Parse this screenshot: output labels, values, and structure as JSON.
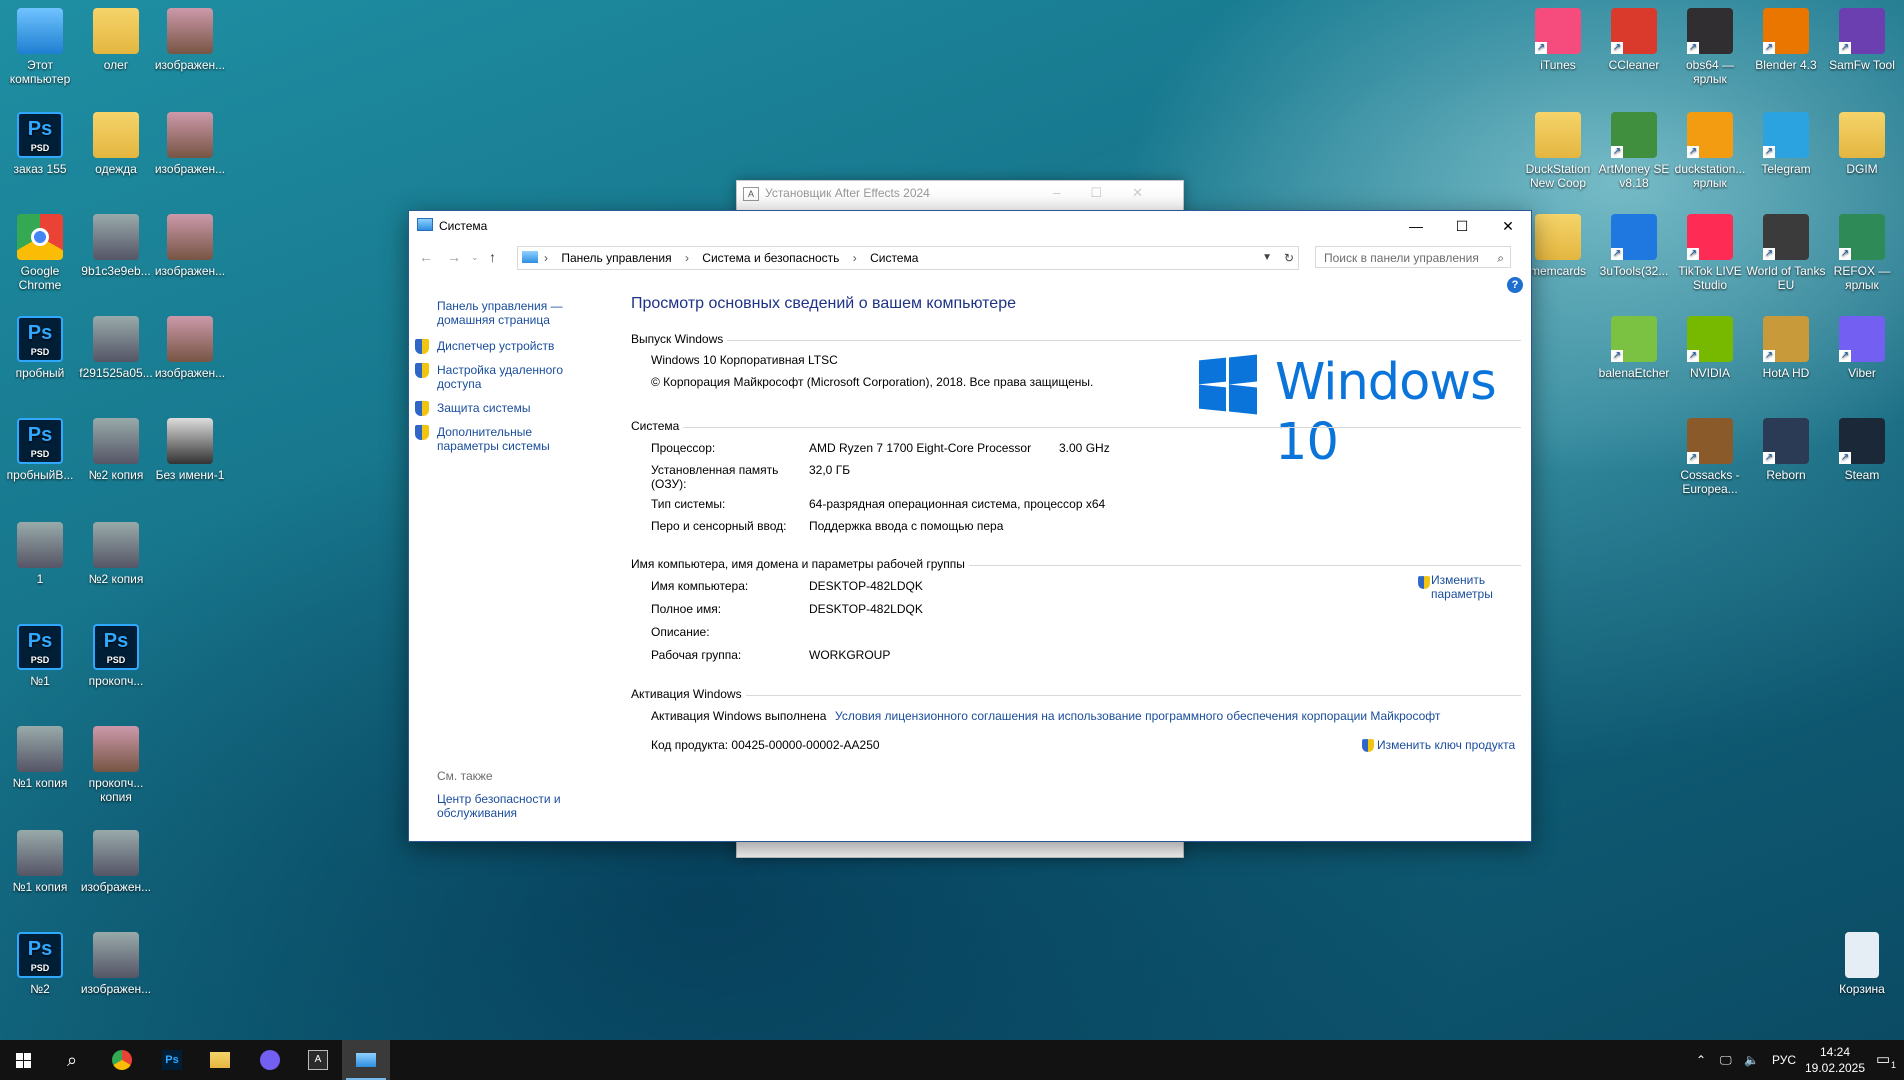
{
  "desktop": {
    "left_icons": [
      {
        "label": "Этот компьютер",
        "icon": "computer-icon"
      },
      {
        "label": "олег",
        "icon": "folder-icon"
      },
      {
        "label": "изображен...",
        "icon": "photo-icon"
      },
      {
        "label": "заказ 155",
        "icon": "psd-icon"
      },
      {
        "label": "одежда",
        "icon": "folder-icon"
      },
      {
        "label": "изображен...",
        "icon": "photo-icon"
      },
      {
        "label": "Google Chrome",
        "icon": "chrome-icon"
      },
      {
        "label": "9b1c3e9eb...",
        "icon": "photo-icon"
      },
      {
        "label": "изображен...",
        "icon": "photo-icon"
      },
      {
        "label": "пробный",
        "icon": "psd-icon"
      },
      {
        "label": "f291525a05...",
        "icon": "photo-icon"
      },
      {
        "label": "изображен...",
        "icon": "photo-icon"
      },
      {
        "label": "пробныйВ...",
        "icon": "psd-icon"
      },
      {
        "label": "№2 копия",
        "icon": "photo-icon"
      },
      {
        "label": "Без имени-1",
        "icon": "image-icon"
      },
      {
        "label": "1",
        "icon": "photo-icon"
      },
      {
        "label": "№2 копия",
        "icon": "photo-icon"
      },
      {
        "label": "№1",
        "icon": "psd-icon"
      },
      {
        "label": "прокопч...",
        "icon": "psd-icon"
      },
      {
        "label": "№1 копия",
        "icon": "photo-icon"
      },
      {
        "label": "прокопч... копия",
        "icon": "photo-icon"
      },
      {
        "label": "№1 копия",
        "icon": "photo-icon"
      },
      {
        "label": "изображен...",
        "icon": "photo-icon"
      },
      {
        "label": "№2",
        "icon": "psd-icon"
      },
      {
        "label": "изображен...",
        "icon": "photo-icon"
      }
    ],
    "right_icons": [
      {
        "label": "iTunes",
        "icon": "itunes-icon",
        "color": "#f54b7d"
      },
      {
        "label": "CCleaner",
        "icon": "ccleaner-icon",
        "color": "#d93a2b"
      },
      {
        "label": "obs64 — ярлык",
        "icon": "obs-icon",
        "color": "#302e31"
      },
      {
        "label": "Blender 4.3",
        "icon": "blender-icon",
        "color": "#ea7600"
      },
      {
        "label": "SamFw Tool",
        "icon": "samfw-icon",
        "color": "#6b3fb0"
      },
      {
        "label": "DuckStation New Coop",
        "icon": "folder-icon",
        "color": "#e8c04f"
      },
      {
        "label": "ArtMoney SE v8.18",
        "icon": "artmoney-icon",
        "color": "#3f8f3f"
      },
      {
        "label": "duckstation... ярлык",
        "icon": "duckstation-icon",
        "color": "#f39c12"
      },
      {
        "label": "Telegram",
        "icon": "telegram-icon",
        "color": "#2aa3e0"
      },
      {
        "label": "DGIM",
        "icon": "folder-icon",
        "color": "#e8c04f"
      },
      {
        "label": "memcards",
        "icon": "folder-icon",
        "color": "#e8c04f"
      },
      {
        "label": "3uTools(32...",
        "icon": "3utools-icon",
        "color": "#1f78e0"
      },
      {
        "label": "TikTok LIVE Studio",
        "icon": "tiktok-icon",
        "color": "#fe2c55"
      },
      {
        "label": "World of Tanks EU",
        "icon": "wot-icon",
        "color": "#3b3b3b"
      },
      {
        "label": "REFOX — ярлык",
        "icon": "refox-icon",
        "color": "#2e8b57"
      },
      {
        "label": "balenaEtcher",
        "icon": "etcher-icon",
        "color": "#7cc242"
      },
      {
        "label": "NVIDIA",
        "icon": "nvidia-icon",
        "color": "#76b900"
      },
      {
        "label": "HotA HD",
        "icon": "hota-icon",
        "color": "#c99a3a"
      },
      {
        "label": "Viber",
        "icon": "viber-icon",
        "color": "#7360f2"
      },
      {
        "label": "Cossacks - Europea...",
        "icon": "cossacks-icon",
        "color": "#8b5a2b"
      },
      {
        "label": "Reborn",
        "icon": "reborn-icon",
        "color": "#2b3a55"
      },
      {
        "label": "Steam",
        "icon": "steam-icon",
        "color": "#1b2838"
      },
      {
        "label": "Корзина",
        "icon": "recycle-bin-icon",
        "color": "#e6eef5"
      }
    ]
  },
  "background_window": {
    "title": "Установщик After Effects 2024"
  },
  "window": {
    "title": "Система",
    "minimize": "—",
    "maximize": "☐",
    "close": "✕",
    "address": {
      "parts": [
        "Панель управления",
        "Система и безопасность",
        "Система"
      ],
      "search_placeholder": "Поиск в панели управления"
    },
    "sidebar": {
      "home": "Панель управления — домашняя страница",
      "items": [
        "Диспетчер устройств",
        "Настройка удаленного доступа",
        "Защита системы",
        "Дополнительные параметры системы"
      ],
      "see_also": "См. также",
      "security_center": "Центр безопасности и обслуживания"
    },
    "main": {
      "heading": "Просмотр основных сведений о вашем компьютере",
      "edition": {
        "section": "Выпуск Windows",
        "name": "Windows 10 Корпоративная LTSC",
        "copyright": "© Корпорация Майкрософт (Microsoft Corporation), 2018. Все права защищены.",
        "logo_text": "Windows 10"
      },
      "system": {
        "section": "Система",
        "processor_label": "Процессор:",
        "processor_value": "AMD Ryzen 7 1700 Eight-Core Processor",
        "processor_speed": "3.00 GHz",
        "ram_label": "Установленная память (ОЗУ):",
        "ram_value": "32,0 ГБ",
        "type_label": "Тип системы:",
        "type_value": "64-разрядная операционная система, процессор x64",
        "pen_label": "Перо и сенсорный ввод:",
        "pen_value": "Поддержка ввода с помощью пера"
      },
      "computer": {
        "section": "Имя компьютера, имя домена и параметры рабочей группы",
        "name_label": "Имя компьютера:",
        "name_value": "DESKTOP-482LDQK",
        "full_label": "Полное имя:",
        "full_value": "DESKTOP-482LDQK",
        "desc_label": "Описание:",
        "workgroup_label": "Рабочая группа:",
        "workgroup_value": "WORKGROUP",
        "change_link": "Изменить параметры"
      },
      "activation": {
        "section": "Активация Windows",
        "status": "Активация Windows выполнена",
        "license_link": "Условия лицензионного соглашения на использование программного обеспечения корпорации Майкрософт",
        "product_key_label": "Код продукта:",
        "product_key_value": "00425-00000-00002-AA250",
        "change_key_link": "Изменить ключ продукта"
      }
    }
  },
  "taskbar": {
    "apps": [
      "start-icon",
      "search-icon",
      "chrome-icon",
      "photoshop-icon",
      "explorer-icon",
      "viber-icon",
      "adobe-installer-icon",
      "control-panel-icon"
    ],
    "language": "РУС",
    "time": "14:24",
    "date": "19.02.2025",
    "notification_count": "1"
  }
}
